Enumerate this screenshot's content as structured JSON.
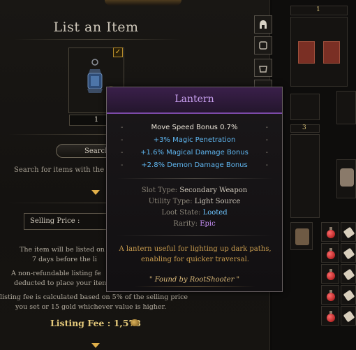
{
  "panel": {
    "title": "List an Item",
    "quantity": "1",
    "search_button_label": "Search",
    "search_hint": "Search for items with the s",
    "selling_price_label": "Selling Price",
    "selling_price_colon": ":",
    "info_lines": [
      "The item will be listed on",
      "7 days before the li",
      "A non-refundable listing fe",
      "deducted to place your iten",
      "listing fee is calculated based on 5% of the selling price",
      "you set or 15 gold whichever value is higher."
    ],
    "listing_fee_text": "Listing Fee : 1,578"
  },
  "inventory": {
    "stack_counts": [
      "1",
      "3"
    ]
  },
  "tooltip": {
    "title": "Lantern",
    "main_stat": "Move Speed Bonus 0.7%",
    "bonus_stats": [
      "+3% Magic Penetration",
      "+1.6% Magical Damage Bonus",
      "+2.8% Demon Damage Bonus"
    ],
    "dash": "-",
    "slot_type_key": "Slot Type:",
    "slot_type_value": "Secondary Weapon",
    "utility_type_key": "Utility Type:",
    "utility_type_value": "Light Source",
    "loot_state_key": "Loot State:",
    "loot_state_value": "Looted",
    "rarity_key": "Rarity:",
    "rarity_value": "Epic",
    "description_line1": "A lantern useful for lighting up dark paths,",
    "description_line2": "enabling for quicker traversal.",
    "found_by": "\" Found by RootShooter \""
  },
  "colors": {
    "epic": "#c58ef5",
    "looted": "#6ec6ff",
    "bonus": "#5fb6f0",
    "gold": "#e3c87a"
  }
}
